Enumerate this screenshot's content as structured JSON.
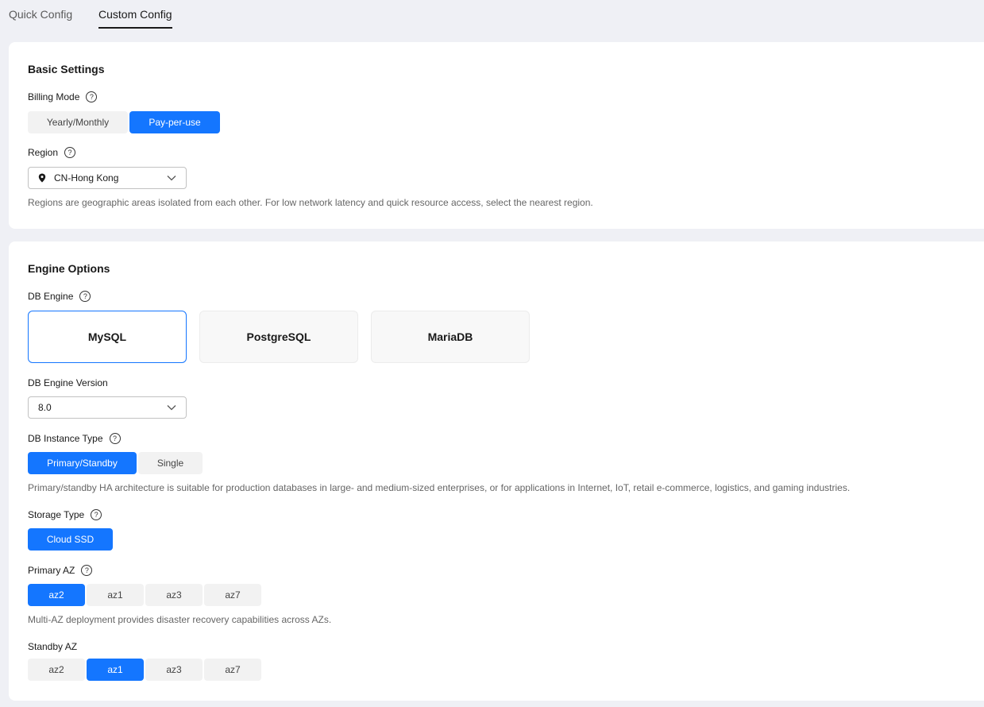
{
  "tabs": [
    {
      "label": "Quick Config",
      "active": false
    },
    {
      "label": "Custom Config",
      "active": true
    }
  ],
  "basic": {
    "title": "Basic Settings",
    "billing_label": "Billing Mode",
    "billing_options": [
      "Yearly/Monthly",
      "Pay-per-use"
    ],
    "billing_selected": "Pay-per-use",
    "region_label": "Region",
    "region_value": "CN-Hong Kong",
    "region_hint": "Regions are geographic areas isolated from each other. For low network latency and quick resource access, select the nearest region."
  },
  "engine": {
    "title": "Engine Options",
    "db_engine_label": "DB Engine",
    "engines": [
      "MySQL",
      "PostgreSQL",
      "MariaDB"
    ],
    "engine_selected": "MySQL",
    "version_label": "DB Engine Version",
    "version_value": "8.0",
    "instance_type_label": "DB Instance Type",
    "instance_types": [
      "Primary/Standby",
      "Single"
    ],
    "instance_type_selected": "Primary/Standby",
    "instance_type_hint": "Primary/standby HA architecture is suitable for production databases in large- and medium-sized enterprises, or for applications in Internet, IoT, retail e-commerce, logistics, and gaming industries.",
    "storage_label": "Storage Type",
    "storage_options": [
      "Cloud SSD"
    ],
    "storage_selected": "Cloud SSD",
    "primary_az_label": "Primary AZ",
    "primary_az_options": [
      "az2",
      "az1",
      "az3",
      "az7"
    ],
    "primary_az_selected": "az2",
    "primary_az_hint": "Multi-AZ deployment provides disaster recovery capabilities across AZs.",
    "standby_az_label": "Standby AZ",
    "standby_az_options": [
      "az2",
      "az1",
      "az3",
      "az7"
    ],
    "standby_az_selected": "az1"
  },
  "colors": {
    "accent": "#1476ff",
    "background": "#eff0f5"
  },
  "icons": {
    "help": "question-circle-icon",
    "region": "location-pin-icon",
    "dropdown": "chevron-down-icon"
  }
}
